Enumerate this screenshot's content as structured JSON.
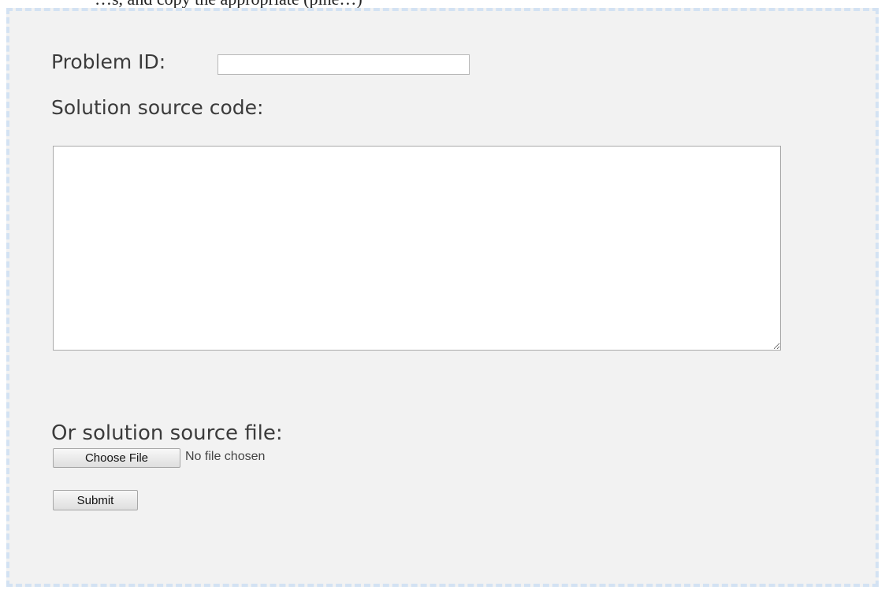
{
  "page": {
    "top_fragment": "…s, and copy the appropriate (pine…)"
  },
  "form": {
    "problem_id_label": "Problem ID:",
    "problem_id_value": "",
    "source_code_label": "Solution source code:",
    "source_code_value": "",
    "source_file_label": "Or solution source file:",
    "choose_file_label": "Choose File",
    "file_status": "No file chosen",
    "submit_label": "Submit"
  },
  "colors": {
    "panel_background": "#f2f2f2",
    "dashed_border": "#d3e2f3"
  }
}
